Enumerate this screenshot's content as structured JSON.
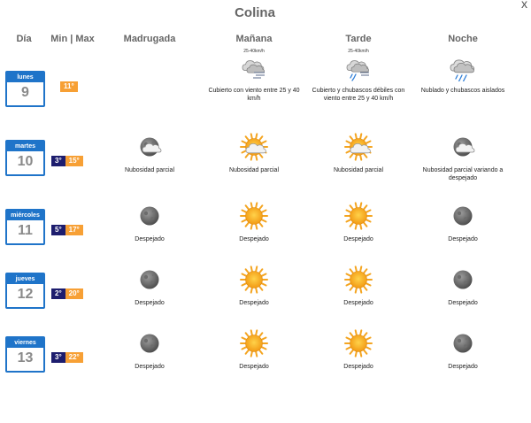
{
  "title": "Colina",
  "close_label": "x",
  "headers": {
    "dia": "Día",
    "minmax": "Min | Max",
    "madrugada": "Madrugada",
    "manana": "Mañana",
    "tarde": "Tarde",
    "noche": "Noche"
  },
  "icon_label_wind": "25-40km/h",
  "days": [
    {
      "name": "lunes",
      "num": "9",
      "min": "",
      "max": "11°",
      "periods": [
        {
          "icon": "",
          "desc": ""
        },
        {
          "icon": "cloud-wind-icon",
          "desc": "Cubierto con viento entre 25 y 40 km/h"
        },
        {
          "icon": "cloud-shower-wind-icon",
          "desc": "Cubierto y chubascos débiles con viento entre 25 y 40 km/h"
        },
        {
          "icon": "cloud-shower-icon",
          "desc": "Nublado y chubascos aislados"
        }
      ]
    },
    {
      "name": "martes",
      "num": "10",
      "min": "3°",
      "max": "15°",
      "periods": [
        {
          "icon": "moon-cloud-icon",
          "desc": "Nubosidad parcial"
        },
        {
          "icon": "sun-cloud-icon",
          "desc": "Nubosidad parcial"
        },
        {
          "icon": "sun-cloud-icon",
          "desc": "Nubosidad parcial"
        },
        {
          "icon": "moon-cloud-icon",
          "desc": "Nubosidad parcial variando a despejado"
        }
      ]
    },
    {
      "name": "miércoles",
      "num": "11",
      "min": "5°",
      "max": "17°",
      "periods": [
        {
          "icon": "moon-icon",
          "desc": "Despejado"
        },
        {
          "icon": "sun-icon",
          "desc": "Despejado"
        },
        {
          "icon": "sun-icon",
          "desc": "Despejado"
        },
        {
          "icon": "moon-icon",
          "desc": "Despejado"
        }
      ]
    },
    {
      "name": "jueves",
      "num": "12",
      "min": "2°",
      "max": "20°",
      "periods": [
        {
          "icon": "moon-icon",
          "desc": "Despejado"
        },
        {
          "icon": "sun-icon",
          "desc": "Despejado"
        },
        {
          "icon": "sun-icon",
          "desc": "Despejado"
        },
        {
          "icon": "moon-icon",
          "desc": "Despejado"
        }
      ]
    },
    {
      "name": "viernes",
      "num": "13",
      "min": "3°",
      "max": "22°",
      "periods": [
        {
          "icon": "moon-icon",
          "desc": "Despejado"
        },
        {
          "icon": "sun-icon",
          "desc": "Despejado"
        },
        {
          "icon": "sun-icon",
          "desc": "Despejado"
        },
        {
          "icon": "moon-icon",
          "desc": "Despejado"
        }
      ]
    }
  ]
}
